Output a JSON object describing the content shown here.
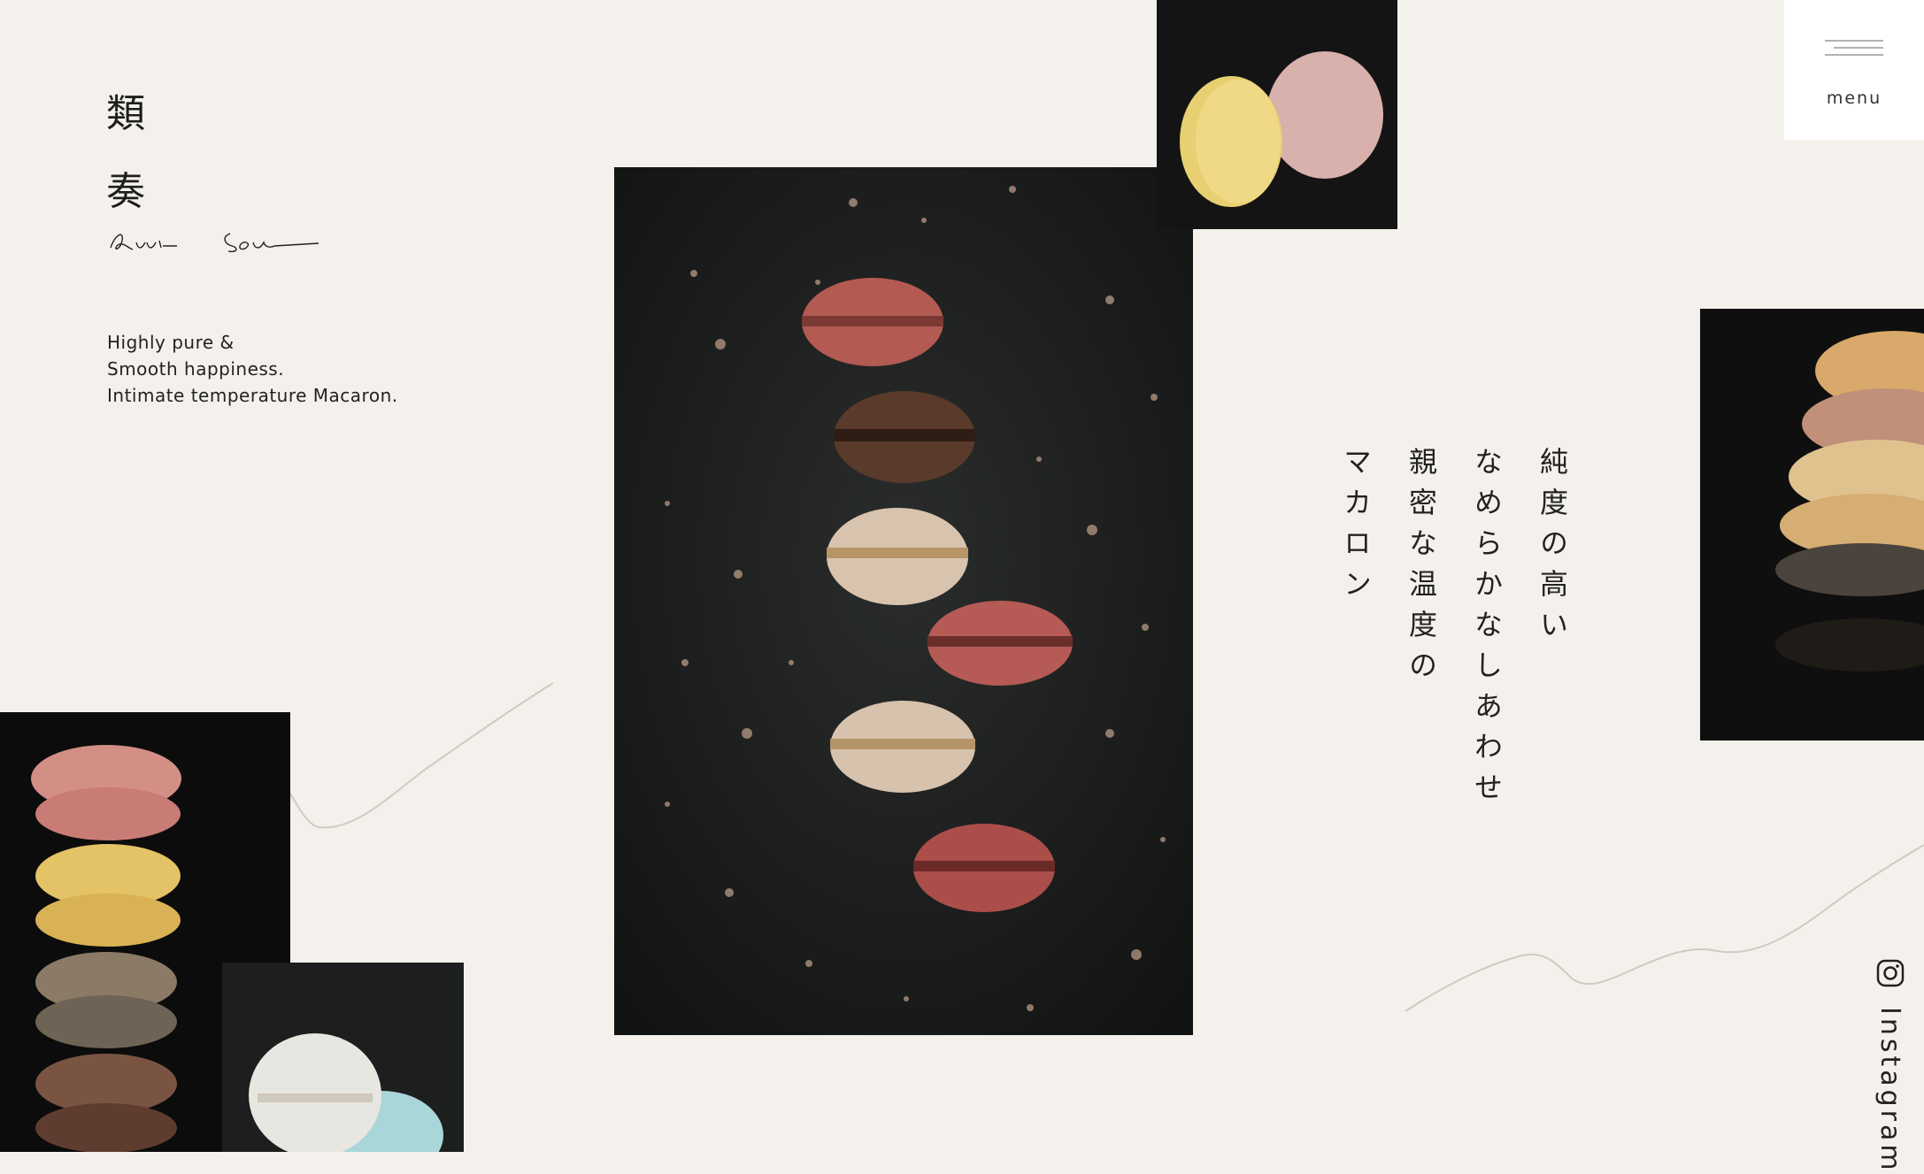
{
  "brand": {
    "char_1": "類",
    "char_2": "奏",
    "script_name": "Rui Sou"
  },
  "tagline": {
    "line_1": "Highly pure &",
    "line_2": "Smooth happiness.",
    "line_3": "Intimate temperature Macaron."
  },
  "vertical_copy": {
    "col_1": "純度の高い",
    "col_2": "なめらかなしあわせ",
    "col_3": "親密な温度の",
    "col_4": "マカロン"
  },
  "menu": {
    "label": "menu"
  },
  "social": {
    "instagram_label": "Instagram",
    "instagram_icon": "instagram-icon"
  },
  "colors": {
    "background": "#f4f1ec",
    "photo_dark": "#131515",
    "menu_bg": "#ffffff",
    "text": "#1e1e1e"
  }
}
